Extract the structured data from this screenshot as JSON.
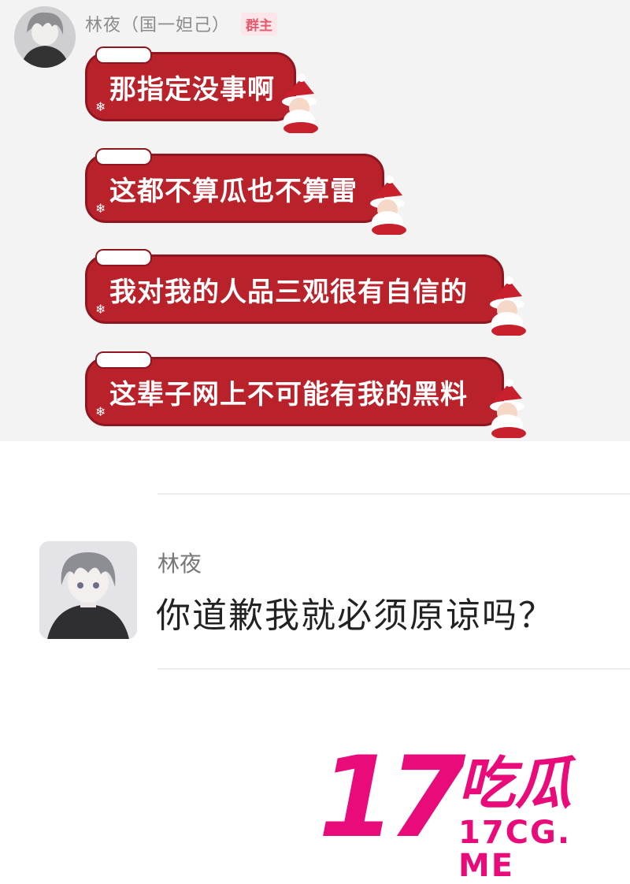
{
  "chat": {
    "sender": "林夜（国一妲己）",
    "role_badge": "群主",
    "messages": [
      "那指定没事啊",
      "这都不算瓜也不算雷",
      "我对我的人品三观很有自信的",
      "这辈子网上不可能有我的黑料"
    ]
  },
  "reply": {
    "name": "林夜",
    "text": "你道歉我就必须原谅吗？"
  },
  "watermark": {
    "number": "17",
    "chinese": "吃瓜",
    "url": "17CG. ME"
  },
  "colors": {
    "bubble": "#b9212b",
    "brand": "#ea0b7b"
  },
  "icons": [
    "avatar-icon",
    "santa-sticker-icon",
    "snowflake-icon"
  ]
}
